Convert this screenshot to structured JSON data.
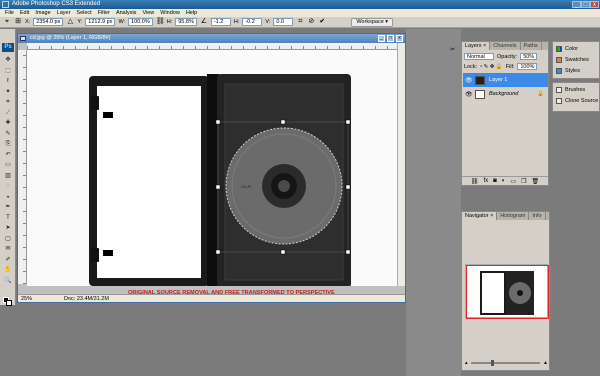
{
  "window": {
    "title": "Adobe Photoshop CS3 Extended",
    "controls": [
      "_",
      "□",
      "x"
    ]
  },
  "menu": [
    "File",
    "Edit",
    "Image",
    "Layer",
    "Select",
    "Filter",
    "Analysis",
    "View",
    "Window",
    "Help"
  ],
  "options_bar": {
    "x_label": "X:",
    "x_value": "2354.0 px",
    "y_label": "Y:",
    "y_value": "1212.9 px",
    "w_label": "W:",
    "w_value": "100.0%",
    "h_label": "H:",
    "h_value": "95.8%",
    "angle_value": "-1.2",
    "h_skew_label": "H:",
    "h_skew_value": "-0.2",
    "v_skew_label": "V:",
    "v_skew_value": "0.0",
    "workspace_label": "Workspace ▾"
  },
  "toolbox": {
    "logo": "Ps",
    "tools": [
      "move-icon",
      "marquee-icon",
      "lasso-icon",
      "magic-wand-icon",
      "crop-icon",
      "slice-icon",
      "healing-icon",
      "brush-icon",
      "stamp-icon",
      "history-brush-icon",
      "eraser-icon",
      "gradient-icon",
      "blur-icon",
      "dodge-icon",
      "pen-icon",
      "type-icon",
      "path-select-icon",
      "shape-icon",
      "notes-icon",
      "eyedropper-icon",
      "hand-icon",
      "zoom-icon"
    ]
  },
  "document": {
    "title": "cd.jpg @ 25% (Layer 1, RGB/8#)",
    "zoom": "25%",
    "doc_size": "Doc: 23.4M/31.2M",
    "caption": "ORIGINAL SOURCE REMOVAL AND FREE TRANSFORMED TO PERSPECTIVE"
  },
  "layers_panel": {
    "tabs": [
      "Layers ×",
      "Channels",
      "Paths"
    ],
    "blend_mode": "Normal",
    "opacity_label": "Opacity:",
    "opacity": "50%",
    "lock_label": "Lock:",
    "fill_label": "Fill:",
    "fill": "100%",
    "layers": [
      {
        "name": "Layer 1",
        "selected": true
      },
      {
        "name": "Background",
        "selected": false
      }
    ]
  },
  "side_panels": {
    "group1": [
      "Color",
      "Swatches",
      "Styles"
    ],
    "group2": [
      "Brushes",
      "Clone Source"
    ]
  },
  "navigator_panel": {
    "tabs": [
      "Navigator ×",
      "Histogram",
      "Info"
    ]
  },
  "colors": {
    "selection": "#3c8ae6",
    "caption": "#c41a1a",
    "nav_box": "#e32626"
  }
}
